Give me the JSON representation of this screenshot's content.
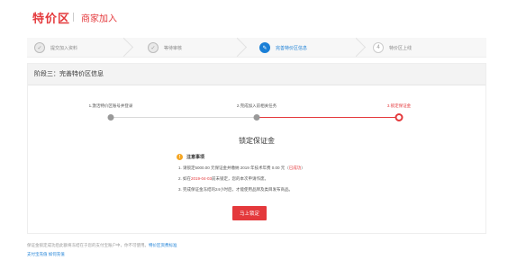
{
  "header": {
    "brand": "特价区",
    "subtitle": "商家加入"
  },
  "steps": [
    {
      "label": "提交加入资料",
      "status": "done",
      "icon": "check-icon",
      "icon_glyph": "✓"
    },
    {
      "label": "等待审核",
      "status": "done",
      "icon": "check-icon",
      "icon_glyph": "✓"
    },
    {
      "label": "完善特价区信息",
      "status": "active",
      "icon": "edit-icon",
      "icon_glyph": "✎"
    },
    {
      "label": "特价区上线",
      "status": "pending",
      "icon": "step-number",
      "icon_glyph": "4"
    }
  ],
  "panel": {
    "title": "阶段三：完善特价区信息"
  },
  "progress": [
    {
      "label": "1.激活特价区账号并登录",
      "state": "done"
    },
    {
      "label": "2.完成加入前相关任务",
      "state": "done"
    },
    {
      "label": "3.锁定保证金",
      "state": "current"
    }
  ],
  "lock": {
    "title": "锁定保证金",
    "notes_heading": "注意事项",
    "note1_prefix": "1. 请锁定5000.00 元保证金并缴纳 2019 年技术年费 0.00 元（",
    "note1_link": "已成功",
    "note1_suffix": "）",
    "note2_prefix": "2. 如在",
    "note2_date": "2019-04-03",
    "note2_suffix": "前未锁定，您的本次申请作废。",
    "note3": "3. 完成保证金冻结的24小时后，才能使用品牌及类目发布商品。",
    "button_label": "马上锁定"
  },
  "footer": {
    "line1_text": "保证金锁定成功后此额将冻结在于您的支付宝账户中，你不可使用。",
    "line1_link": "特价区资费标准",
    "line2_text": "支付宝充值 如何充值"
  },
  "colors": {
    "accent": "#e4393c",
    "link": "#1a7fd6",
    "warn": "#f5a623"
  }
}
